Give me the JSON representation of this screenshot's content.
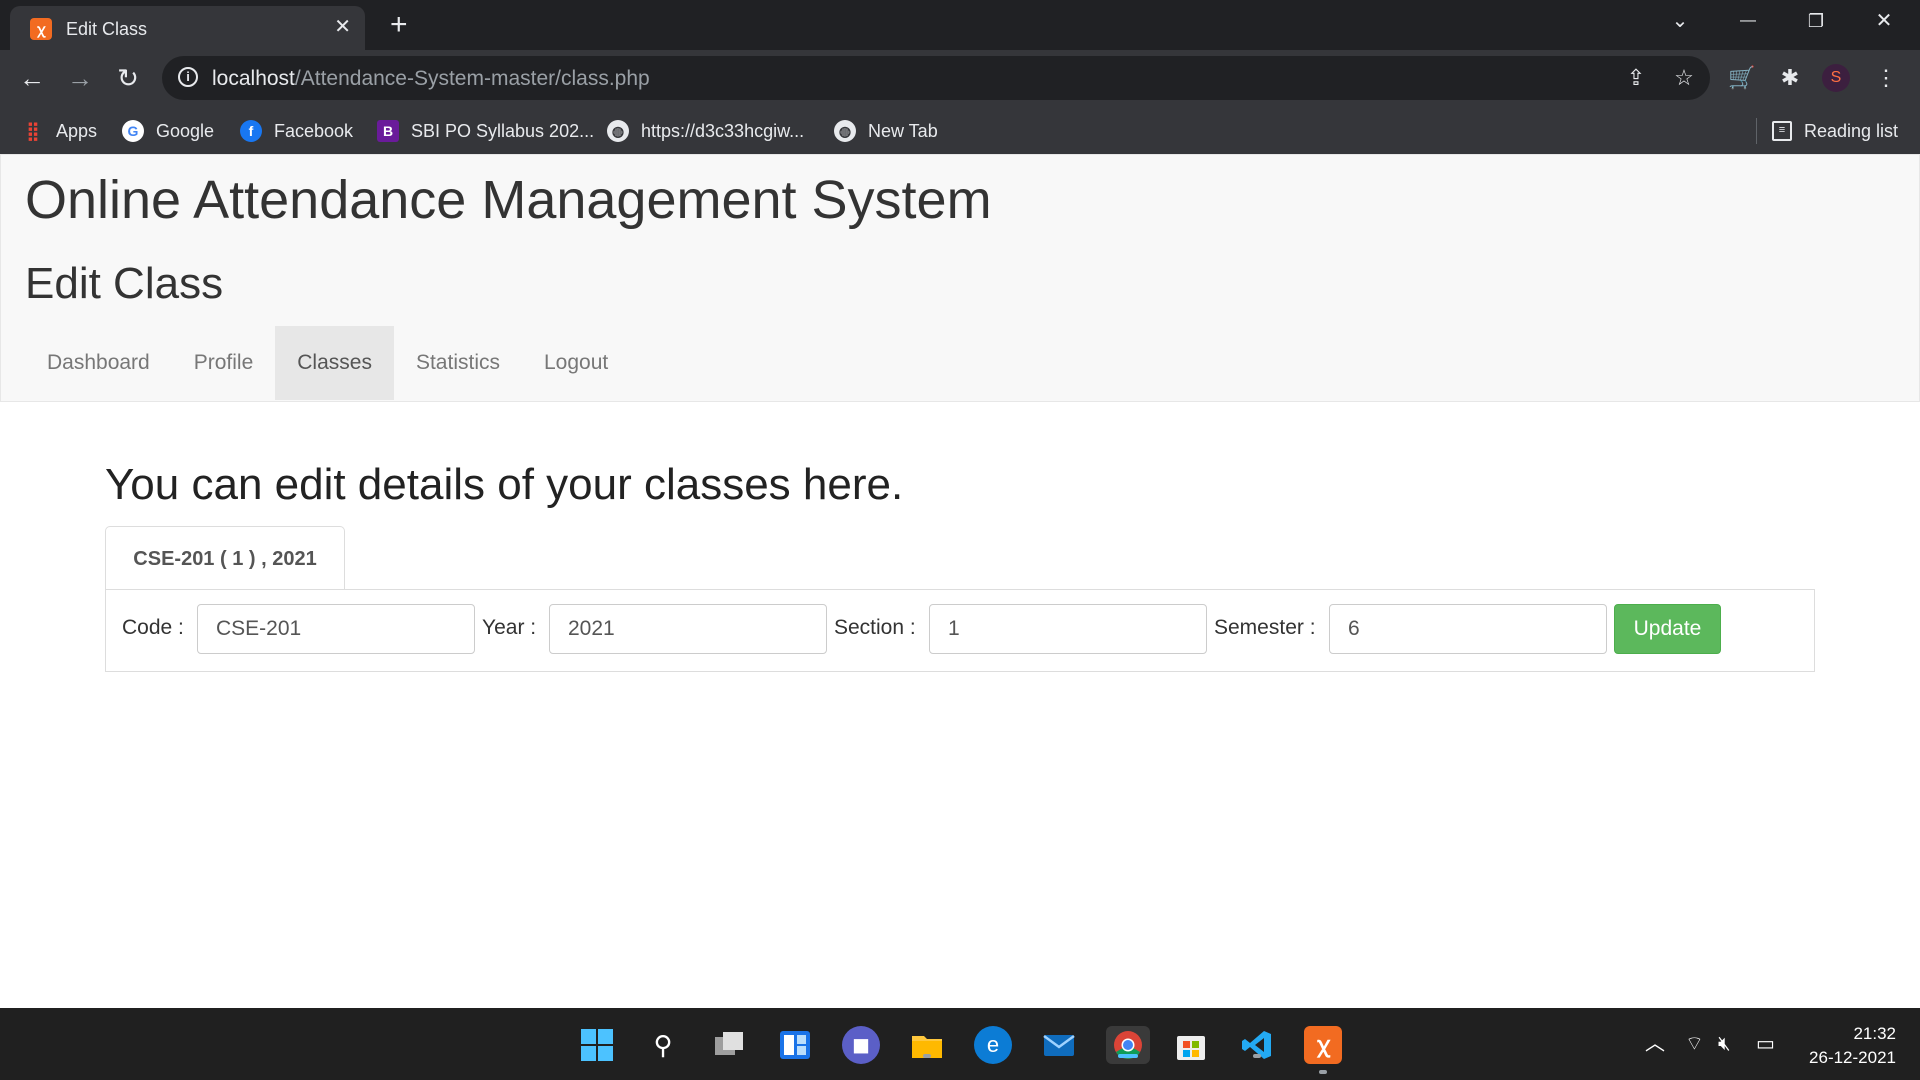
{
  "browser": {
    "tab_title": "Edit Class",
    "tab_close": "✕",
    "new_tab": "+",
    "window_controls": {
      "chevron": "⌄",
      "minimize": "—",
      "restore": "❐",
      "close": "✕"
    },
    "url_host": "localhost",
    "url_path": "/Attendance-System-master/class.php",
    "bookmarks": [
      {
        "label": "Apps",
        "icon": "apps-grid-icon"
      },
      {
        "label": "Google",
        "icon": "google-icon"
      },
      {
        "label": "Facebook",
        "icon": "facebook-icon"
      },
      {
        "label": "SBI PO Syllabus 202...",
        "icon": "bookmark-b-icon"
      },
      {
        "label": "https://d3c33hcgiw...",
        "icon": "globe-icon"
      },
      {
        "label": "New Tab",
        "icon": "globe-icon"
      }
    ],
    "reading_list": "Reading list"
  },
  "header": {
    "site_title": "Online Attendance Management System",
    "page_heading": "Edit Class",
    "nav": [
      {
        "label": "Dashboard",
        "active": false
      },
      {
        "label": "Profile",
        "active": false
      },
      {
        "label": "Classes",
        "active": true
      },
      {
        "label": "Statistics",
        "active": false
      },
      {
        "label": "Logout",
        "active": false
      }
    ]
  },
  "main": {
    "lead": "You can edit details of your classes here.",
    "class_tab": "CSE-201 ( 1 ) , 2021",
    "form": {
      "code_label": "Code :",
      "code_value": "CSE-201",
      "year_label": "Year :",
      "year_value": "2021",
      "section_label": "Section :",
      "section_value": "1",
      "semester_label": "Semester :",
      "semester_value": "6",
      "update_label": "Update"
    }
  },
  "taskbar": {
    "time": "21:32",
    "date": "26-12-2021"
  },
  "colors": {
    "chrome_dark": "#202124",
    "chrome_toolbar": "#35363a",
    "nav_active_bg": "#e7e7e7",
    "button_success": "#5cb85c",
    "taskbar": "#202020"
  }
}
